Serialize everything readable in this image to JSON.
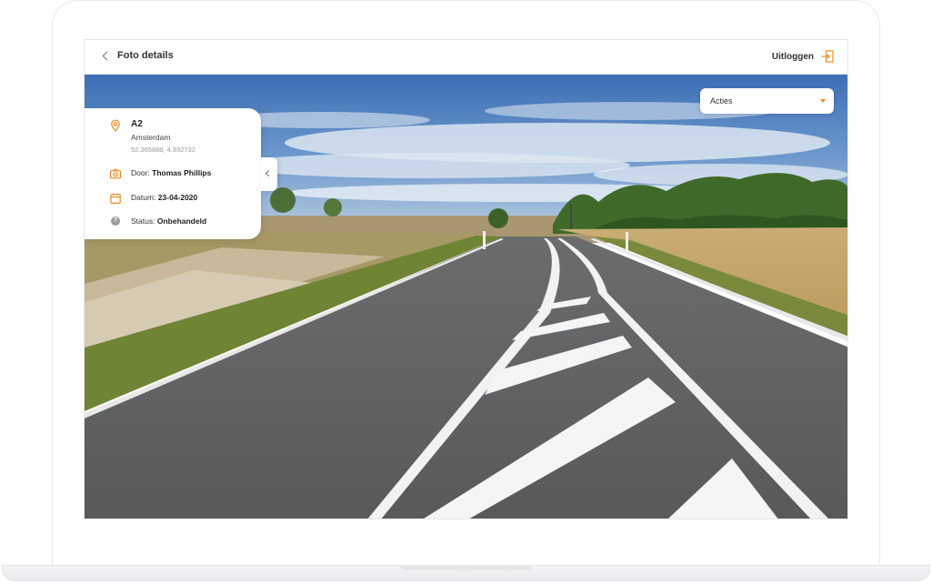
{
  "header": {
    "back_label": "Foto details",
    "logout_label": "Uitloggen"
  },
  "actions": {
    "label": "Acties"
  },
  "photo_info": {
    "location_name": "A2",
    "city": "Amsterdam",
    "coordinates": "52.365888, 4.932732",
    "author_label": "Door:",
    "author_value": "Thomas Phillips",
    "date_label": "Datum:",
    "date_value": "23-04-2020",
    "status_label": "Status:",
    "status_value": "Onbehandeld",
    "status_icon_text": "?"
  },
  "colors": {
    "accent": "#f08a24",
    "text_dark": "#333333",
    "muted": "#999999"
  },
  "icons": [
    "chevron-left-icon",
    "logout-icon",
    "caret-down-icon",
    "location-pin-icon",
    "camera-icon",
    "calendar-icon",
    "status-question-icon"
  ]
}
